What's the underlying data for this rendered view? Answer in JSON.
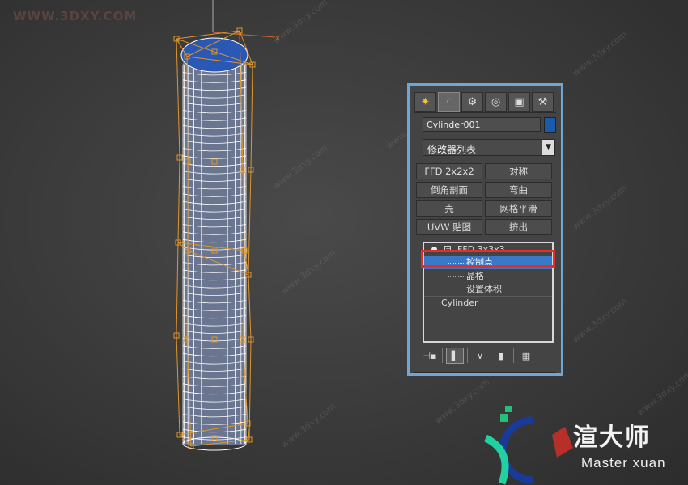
{
  "watermark": {
    "top_left": "WWW.3DXY.COM",
    "repeated": "www.3dxy.com"
  },
  "viewport": {
    "object_name": "Cylinder001",
    "colors": {
      "wire": "#ffffff",
      "lattice": "#e0952a",
      "cap": "#2a58b4",
      "axis": "#d06a30"
    }
  },
  "command_panel": {
    "tabs": [
      {
        "name": "create-tab",
        "glyph": "✷"
      },
      {
        "name": "modify-tab",
        "glyph": "◜"
      },
      {
        "name": "hierarchy-tab",
        "glyph": "⚙"
      },
      {
        "name": "motion-tab",
        "glyph": "◎"
      },
      {
        "name": "display-tab",
        "glyph": "▣"
      },
      {
        "name": "utilities-tab",
        "glyph": "⚒"
      }
    ],
    "object_name": "Cylinder001",
    "object_color": "#1a5aa8",
    "modifier_list": "修改器列表",
    "buttons": {
      "ffd": "FFD 2x2x2",
      "symmetry": "对称",
      "chamfer": "倒角剖面",
      "bend": "弯曲",
      "shell": "壳",
      "meshsmooth": "网格平滑",
      "uvw": "UVW 贴图",
      "extrude": "挤出"
    },
    "stack": {
      "ffd": "FFD 3x3x3",
      "control_points": "控制点",
      "lattice": "晶格",
      "set_volume": "设置体积",
      "cylinder": "Cylinder"
    },
    "highlight_color": "#e0302a"
  },
  "logo": {
    "cn": "渲大师",
    "en": "Master xuan"
  }
}
